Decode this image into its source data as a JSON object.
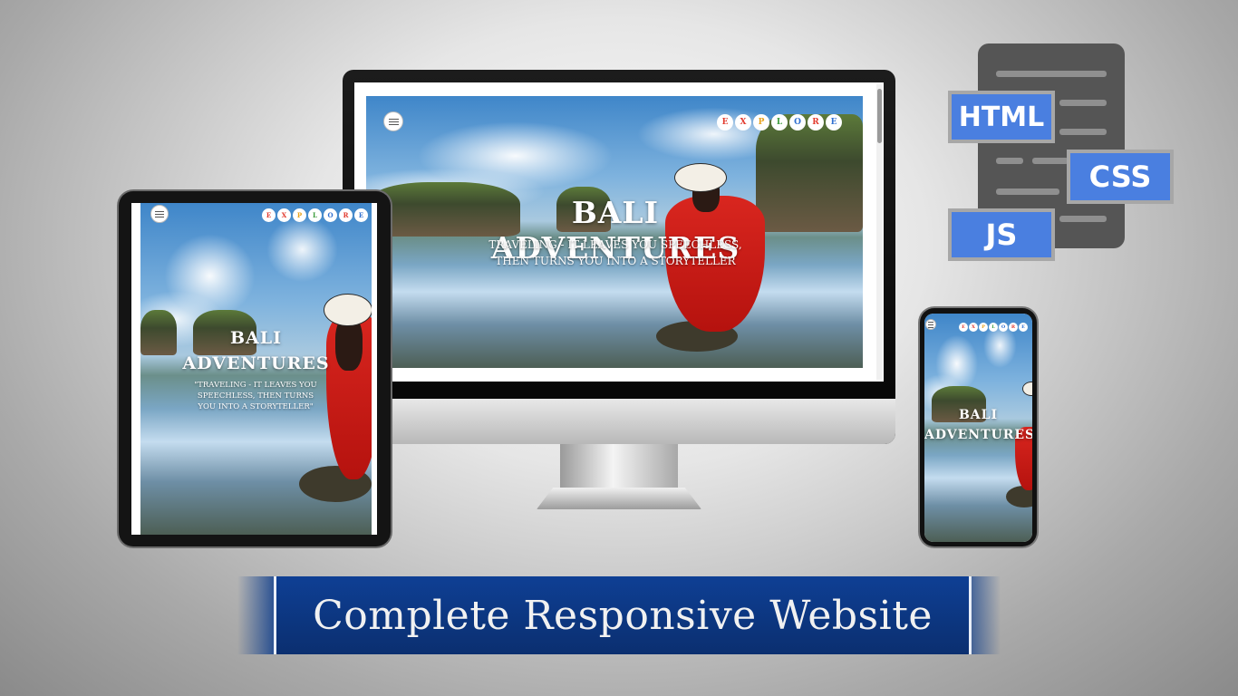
{
  "desktop": {
    "hero_title": "BALI ADVENTURES",
    "hero_subtitle_line1": "TRAVELING - IT LEAVES YOU SPEECHLESS,",
    "hero_subtitle_line2": "THEN TURNS YOU INTO A STORYTELLER"
  },
  "tablet": {
    "hero_title_line1": "BALI",
    "hero_title_line2": "ADVENTURES",
    "hero_subtitle": "\"TRAVELING - IT LEAVES YOU SPEECHLESS, THEN TURNS YOU INTO A STORYTELLER\""
  },
  "phone": {
    "hero_title_line1": "BALI",
    "hero_title_line2": "ADVENTURES"
  },
  "explore_letters": [
    {
      "letter": "E",
      "color": "#e23b2e"
    },
    {
      "letter": "X",
      "color": "#e23b2e"
    },
    {
      "letter": "P",
      "color": "#e8a21c"
    },
    {
      "letter": "L",
      "color": "#3a9a3a"
    },
    {
      "letter": "O",
      "color": "#2f6fd0"
    },
    {
      "letter": "R",
      "color": "#e23b2e"
    },
    {
      "letter": "E",
      "color": "#2f6fd0"
    }
  ],
  "tech_badges": {
    "html": "HTML",
    "css": "CSS",
    "js": "JS"
  },
  "banner": {
    "text": "Complete Responsive Website"
  },
  "icons": [
    "hamburger-menu-icon",
    "code-document-icon"
  ],
  "colors": {
    "banner_blue": "#0b3a86",
    "badge_blue": "#4a7fe0",
    "dress_red": "#c8201a"
  }
}
